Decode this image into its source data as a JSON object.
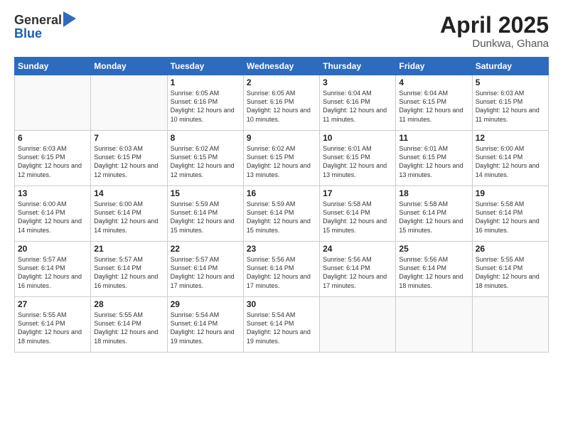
{
  "logo": {
    "general": "General",
    "blue": "Blue"
  },
  "title": {
    "month": "April 2025",
    "location": "Dunkwa, Ghana"
  },
  "days_header": [
    "Sunday",
    "Monday",
    "Tuesday",
    "Wednesday",
    "Thursday",
    "Friday",
    "Saturday"
  ],
  "weeks": [
    [
      {
        "day": "",
        "info": ""
      },
      {
        "day": "",
        "info": ""
      },
      {
        "day": "1",
        "info": "Sunrise: 6:05 AM\nSunset: 6:16 PM\nDaylight: 12 hours and 10 minutes."
      },
      {
        "day": "2",
        "info": "Sunrise: 6:05 AM\nSunset: 6:16 PM\nDaylight: 12 hours and 10 minutes."
      },
      {
        "day": "3",
        "info": "Sunrise: 6:04 AM\nSunset: 6:16 PM\nDaylight: 12 hours and 11 minutes."
      },
      {
        "day": "4",
        "info": "Sunrise: 6:04 AM\nSunset: 6:15 PM\nDaylight: 12 hours and 11 minutes."
      },
      {
        "day": "5",
        "info": "Sunrise: 6:03 AM\nSunset: 6:15 PM\nDaylight: 12 hours and 11 minutes."
      }
    ],
    [
      {
        "day": "6",
        "info": "Sunrise: 6:03 AM\nSunset: 6:15 PM\nDaylight: 12 hours and 12 minutes."
      },
      {
        "day": "7",
        "info": "Sunrise: 6:03 AM\nSunset: 6:15 PM\nDaylight: 12 hours and 12 minutes."
      },
      {
        "day": "8",
        "info": "Sunrise: 6:02 AM\nSunset: 6:15 PM\nDaylight: 12 hours and 12 minutes."
      },
      {
        "day": "9",
        "info": "Sunrise: 6:02 AM\nSunset: 6:15 PM\nDaylight: 12 hours and 13 minutes."
      },
      {
        "day": "10",
        "info": "Sunrise: 6:01 AM\nSunset: 6:15 PM\nDaylight: 12 hours and 13 minutes."
      },
      {
        "day": "11",
        "info": "Sunrise: 6:01 AM\nSunset: 6:15 PM\nDaylight: 12 hours and 13 minutes."
      },
      {
        "day": "12",
        "info": "Sunrise: 6:00 AM\nSunset: 6:14 PM\nDaylight: 12 hours and 14 minutes."
      }
    ],
    [
      {
        "day": "13",
        "info": "Sunrise: 6:00 AM\nSunset: 6:14 PM\nDaylight: 12 hours and 14 minutes."
      },
      {
        "day": "14",
        "info": "Sunrise: 6:00 AM\nSunset: 6:14 PM\nDaylight: 12 hours and 14 minutes."
      },
      {
        "day": "15",
        "info": "Sunrise: 5:59 AM\nSunset: 6:14 PM\nDaylight: 12 hours and 15 minutes."
      },
      {
        "day": "16",
        "info": "Sunrise: 5:59 AM\nSunset: 6:14 PM\nDaylight: 12 hours and 15 minutes."
      },
      {
        "day": "17",
        "info": "Sunrise: 5:58 AM\nSunset: 6:14 PM\nDaylight: 12 hours and 15 minutes."
      },
      {
        "day": "18",
        "info": "Sunrise: 5:58 AM\nSunset: 6:14 PM\nDaylight: 12 hours and 15 minutes."
      },
      {
        "day": "19",
        "info": "Sunrise: 5:58 AM\nSunset: 6:14 PM\nDaylight: 12 hours and 16 minutes."
      }
    ],
    [
      {
        "day": "20",
        "info": "Sunrise: 5:57 AM\nSunset: 6:14 PM\nDaylight: 12 hours and 16 minutes."
      },
      {
        "day": "21",
        "info": "Sunrise: 5:57 AM\nSunset: 6:14 PM\nDaylight: 12 hours and 16 minutes."
      },
      {
        "day": "22",
        "info": "Sunrise: 5:57 AM\nSunset: 6:14 PM\nDaylight: 12 hours and 17 minutes."
      },
      {
        "day": "23",
        "info": "Sunrise: 5:56 AM\nSunset: 6:14 PM\nDaylight: 12 hours and 17 minutes."
      },
      {
        "day": "24",
        "info": "Sunrise: 5:56 AM\nSunset: 6:14 PM\nDaylight: 12 hours and 17 minutes."
      },
      {
        "day": "25",
        "info": "Sunrise: 5:56 AM\nSunset: 6:14 PM\nDaylight: 12 hours and 18 minutes."
      },
      {
        "day": "26",
        "info": "Sunrise: 5:55 AM\nSunset: 6:14 PM\nDaylight: 12 hours and 18 minutes."
      }
    ],
    [
      {
        "day": "27",
        "info": "Sunrise: 5:55 AM\nSunset: 6:14 PM\nDaylight: 12 hours and 18 minutes."
      },
      {
        "day": "28",
        "info": "Sunrise: 5:55 AM\nSunset: 6:14 PM\nDaylight: 12 hours and 18 minutes."
      },
      {
        "day": "29",
        "info": "Sunrise: 5:54 AM\nSunset: 6:14 PM\nDaylight: 12 hours and 19 minutes."
      },
      {
        "day": "30",
        "info": "Sunrise: 5:54 AM\nSunset: 6:14 PM\nDaylight: 12 hours and 19 minutes."
      },
      {
        "day": "",
        "info": ""
      },
      {
        "day": "",
        "info": ""
      },
      {
        "day": "",
        "info": ""
      }
    ]
  ]
}
